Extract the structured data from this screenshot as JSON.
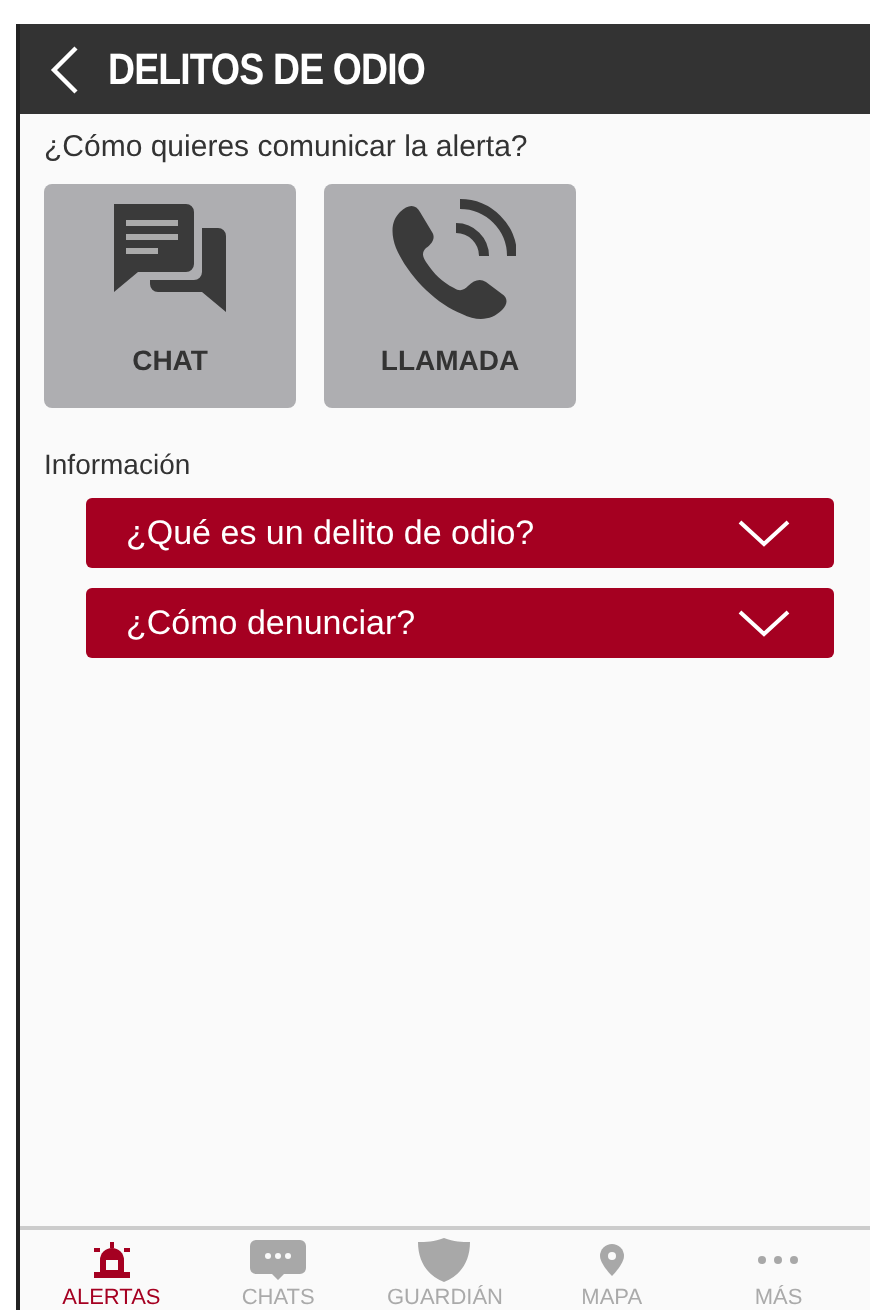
{
  "header": {
    "title": "DELITOS DE ODIO"
  },
  "prompt": "¿Cómo quieres comunicar la alerta?",
  "options": [
    {
      "kind": "chat",
      "label": "CHAT"
    },
    {
      "kind": "call",
      "label": "LLAMADA"
    }
  ],
  "info": {
    "heading": "Información",
    "items": [
      {
        "label": "¿Qué es un delito de odio?",
        "expanded": false
      },
      {
        "label": "¿Cómo denunciar?",
        "expanded": false
      }
    ]
  },
  "tabs": [
    {
      "kind": "alerts",
      "label": "ALERTAS",
      "selected": true
    },
    {
      "kind": "chats",
      "label": "CHATS",
      "selected": false
    },
    {
      "kind": "guardian",
      "label": "GUARDIÁN",
      "selected": false
    },
    {
      "kind": "map",
      "label": "MAPA",
      "selected": false
    },
    {
      "kind": "more",
      "label": "MÁS",
      "selected": false
    }
  ]
}
